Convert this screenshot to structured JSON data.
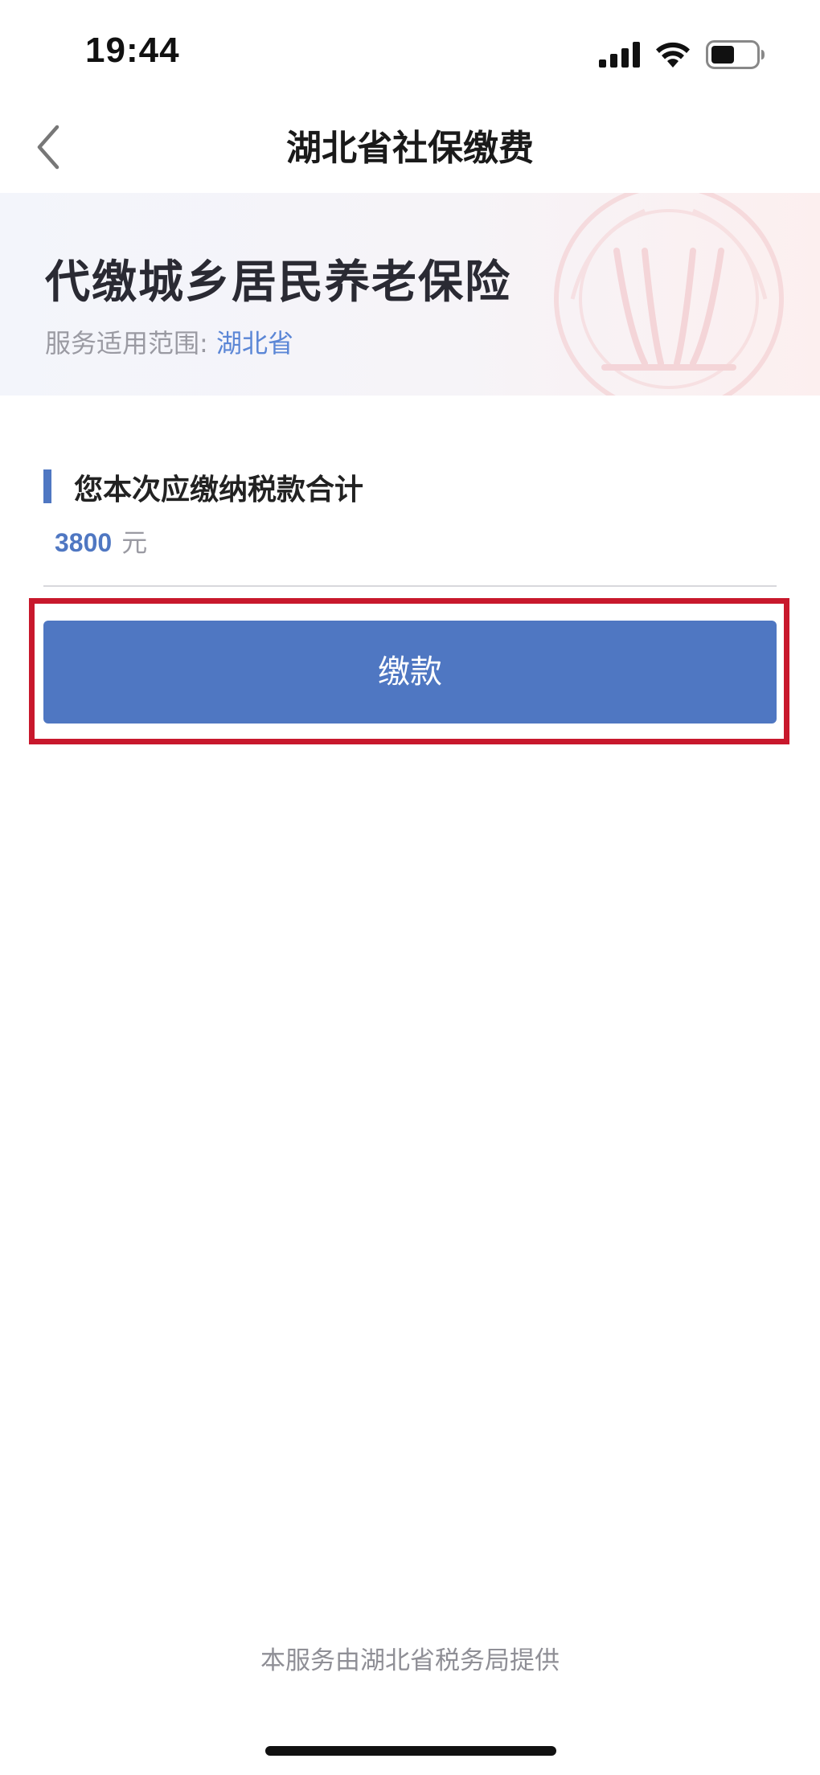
{
  "status_bar": {
    "time": "19:44"
  },
  "nav": {
    "title": "湖北省社保缴费",
    "back_icon": "chevron-left-icon"
  },
  "hero": {
    "title": "代缴城乡居民养老保险",
    "scope_label": "服务适用范围:",
    "scope_value": "湖北省"
  },
  "amount": {
    "section_title": "您本次应缴纳税款合计",
    "value": "3800",
    "unit": "元"
  },
  "actions": {
    "pay_label": "缴款"
  },
  "footer": {
    "text": "本服务由湖北省税务局提供"
  },
  "colors": {
    "accent": "#4f77c2",
    "highlight": "#c8182c",
    "scope_value": "#5b86d6"
  }
}
